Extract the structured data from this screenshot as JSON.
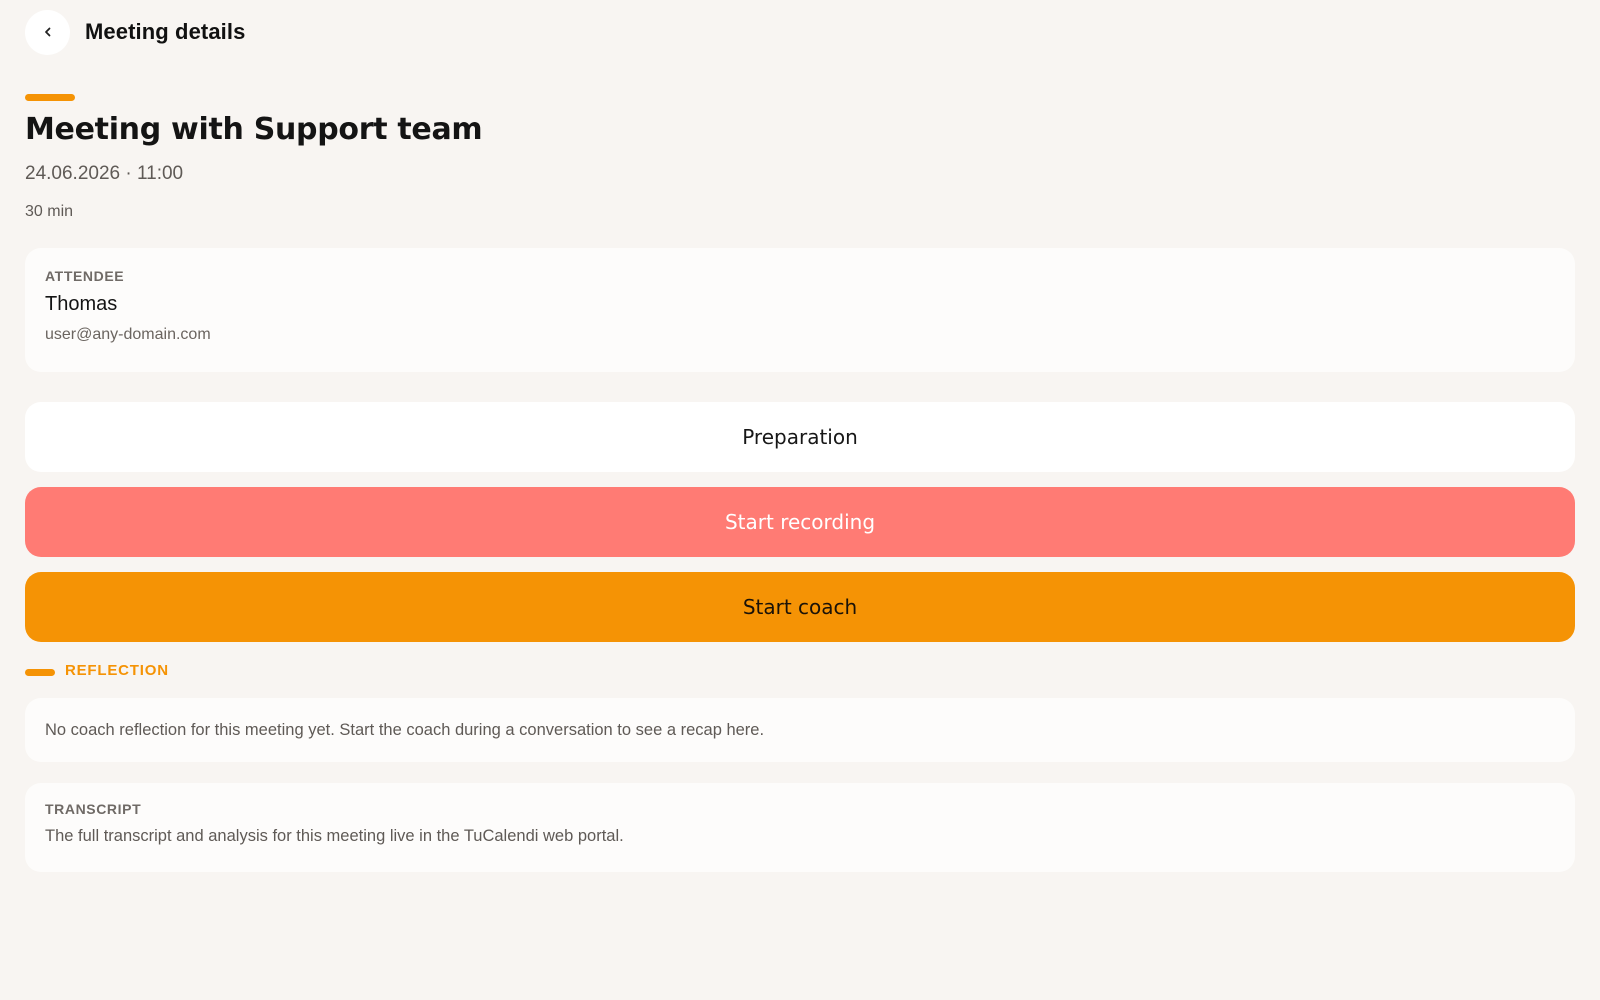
{
  "header": {
    "title": "Meeting details",
    "back_icon": "chevron-left-icon"
  },
  "meeting": {
    "title": "Meeting with Support team",
    "datetime": "24.06.2026 · 11:00",
    "duration": "30 min"
  },
  "attendee": {
    "label": "ATTENDEE",
    "name": "Thomas",
    "email": "user@any-domain.com"
  },
  "actions": {
    "preparation": "Preparation",
    "start_recording": "Start recording",
    "start_coach": "Start coach"
  },
  "reflection": {
    "label": "REFLECTION",
    "text": "No coach reflection for this meeting yet. Start the coach during a conversation to see a recap here."
  },
  "transcript": {
    "label": "TRANSCRIPT",
    "text": "The full transcript and analysis for this meeting live in the TuCalendi web portal."
  },
  "colors": {
    "accent": "#f59305",
    "record": "#ff7b74",
    "background": "#f8f5f2",
    "card": "#fdfcfb"
  }
}
